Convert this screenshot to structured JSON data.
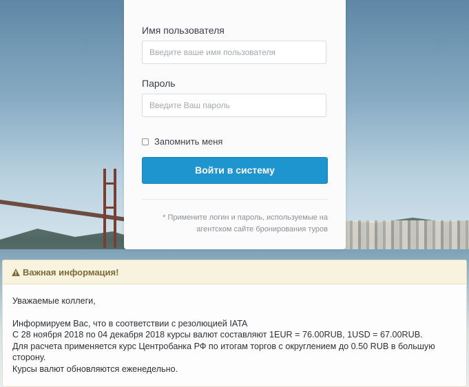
{
  "login": {
    "username_label": "Имя пользователя",
    "username_placeholder": "Введите ваше имя пользователя",
    "password_label": "Пароль",
    "password_placeholder": "Введите Ваш пароль",
    "remember_label": "Запомнить меня",
    "remember_checked": false,
    "submit_label": "Войти в систему",
    "hint_line1": "* Примените логин и пароль, используемые на",
    "hint_line2": "агентском сайте бронирования туров"
  },
  "info": {
    "icon": "warning-icon",
    "title": "Важная информация!",
    "greeting": "Уважаемые коллеги,",
    "line1": "Информируем Вас, что в соответствии с резолюцией IATA",
    "line2": "С 28 ноября 2018 по 04 декабря 2018 курсы валют составляют 1EUR = 76.00RUB, 1USD = 67.00RUB.",
    "line3": "Для расчета применяется курс Центробанка РФ по итогам торгов с округлением до 0.50 RUB в большую сторону.",
    "line4": "Курсы валют обновляются еженедельно."
  },
  "colors": {
    "primary_button": "#1f95d0",
    "warning_header_bg": "#f7f3de",
    "warning_text": "#7d6a3a"
  }
}
